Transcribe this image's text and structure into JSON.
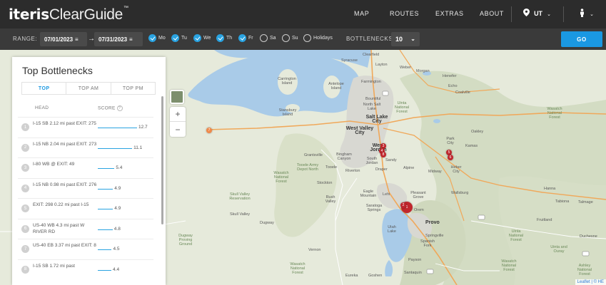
{
  "brand": {
    "bold": "iteris",
    "rest": "ClearGuide",
    "tm": "™"
  },
  "nav": {
    "items": [
      "MAP",
      "ROUTES",
      "EXTRAS",
      "ABOUT"
    ],
    "state": "UT",
    "location_icon": "location-pin-icon",
    "user_icon": "user-icon"
  },
  "filters": {
    "range_label": "RANGE:",
    "start_date": "07/01/2023",
    "end_date": "07/31/2023",
    "arrow": "→",
    "days": [
      {
        "label": "Mo",
        "checked": true
      },
      {
        "label": "Tu",
        "checked": true
      },
      {
        "label": "We",
        "checked": true
      },
      {
        "label": "Th",
        "checked": true
      },
      {
        "label": "Fr",
        "checked": true
      },
      {
        "label": "Sa",
        "checked": false
      },
      {
        "label": "Su",
        "checked": false
      },
      {
        "label": "Holidays",
        "checked": false
      }
    ],
    "bottlenecks_label": "BOTTLENECKS:",
    "bottlenecks_value": "10",
    "go_label": "GO"
  },
  "colors": {
    "accent": "#1a98e2",
    "nav_bg": "#2c2c2c",
    "filter_bg": "#3a3a3a",
    "marker": "#c0272d",
    "water": "#a9cbe8"
  },
  "panel": {
    "title": "Top Bottlenecks",
    "tabs": [
      {
        "label": "TOP",
        "active": true
      },
      {
        "label": "TOP AM",
        "active": false
      },
      {
        "label": "TOP PM",
        "active": false
      }
    ],
    "col_head": "HEAD",
    "col_score": "SCORE",
    "help": "?",
    "rows": [
      {
        "rank": "1",
        "head": "I-15 SB 2.12 mi past EXIT: 275",
        "score": "12.7"
      },
      {
        "rank": "2",
        "head": "I-15 NB 2.04 mi past EXIT: 273",
        "score": "11.1"
      },
      {
        "rank": "3",
        "head": "I-80 WB @ EXIT: 49",
        "score": "5.4"
      },
      {
        "rank": "4",
        "head": "I-15 NB 0.98 mi past EXIT: 276",
        "score": "4.9"
      },
      {
        "rank": "5",
        "head": "EXIT: 298 0.22 mi past I-15",
        "score": "4.9"
      },
      {
        "rank": "6",
        "head": "US-40 WB 4.3 mi past W RIVER RD",
        "score": "4.8"
      },
      {
        "rank": "7",
        "head": "US-40 EB 3.37 mi past EXIT: 8",
        "score": "4.5"
      },
      {
        "rank": "8",
        "head": "I-15 SB 1.72 mi past",
        "score": "4.4"
      }
    ]
  },
  "map": {
    "zoom_in": "+",
    "zoom_out": "−",
    "attribution": "Leaflet | © HE",
    "labels": [
      {
        "text": "Clearfield",
        "cls": ""
      },
      {
        "text": "Syracuse",
        "cls": ""
      },
      {
        "text": "Layton",
        "cls": ""
      },
      {
        "text": "Morgan",
        "cls": ""
      },
      {
        "text": "Henefer",
        "cls": ""
      },
      {
        "text": "Echo",
        "cls": ""
      },
      {
        "text": "Coalville",
        "cls": ""
      },
      {
        "text": "Farmington",
        "cls": ""
      },
      {
        "text": "Antelope Island",
        "cls": ""
      },
      {
        "text": "Carrington Island",
        "cls": ""
      },
      {
        "text": "Stansbury Island",
        "cls": ""
      },
      {
        "text": "Bountiful",
        "cls": ""
      },
      {
        "text": "North Salt Lake",
        "cls": ""
      },
      {
        "text": "Salt Lake City",
        "cls": "city"
      },
      {
        "text": "West Valley City",
        "cls": "city"
      },
      {
        "text": "West Jordan",
        "cls": "city"
      },
      {
        "text": "South Jordan",
        "cls": ""
      },
      {
        "text": "Sandy",
        "cls": ""
      },
      {
        "text": "Draper",
        "cls": ""
      },
      {
        "text": "Riverton",
        "cls": ""
      },
      {
        "text": "Bingham Canyon",
        "cls": ""
      },
      {
        "text": "Grantsville",
        "cls": ""
      },
      {
        "text": "Tooele",
        "cls": ""
      },
      {
        "text": "Tooele Army Depot North",
        "cls": "green"
      },
      {
        "text": "Wasatch National Forest",
        "cls": "green"
      },
      {
        "text": "Stockton",
        "cls": ""
      },
      {
        "text": "Rush Valley",
        "cls": ""
      },
      {
        "text": "Skull Valley Reservation",
        "cls": "green"
      },
      {
        "text": "Eagle Mountain",
        "cls": ""
      },
      {
        "text": "Lehi",
        "cls": ""
      },
      {
        "text": "Alpine",
        "cls": ""
      },
      {
        "text": "Pleasant Grove",
        "cls": ""
      },
      {
        "text": "Saratoga Springs",
        "cls": ""
      },
      {
        "text": "Orem",
        "cls": ""
      },
      {
        "text": "Provo",
        "cls": "city"
      },
      {
        "text": "Utah Lake",
        "cls": ""
      },
      {
        "text": "Springville",
        "cls": ""
      },
      {
        "text": "Spanish Fork",
        "cls": ""
      },
      {
        "text": "Payson",
        "cls": ""
      },
      {
        "text": "Santaquin",
        "cls": ""
      },
      {
        "text": "Goshen",
        "cls": ""
      },
      {
        "text": "Eureka",
        "cls": ""
      },
      {
        "text": "Vernon",
        "cls": ""
      },
      {
        "text": "Dugway",
        "cls": ""
      },
      {
        "text": "Dugway Proving Ground",
        "cls": "green"
      },
      {
        "text": "Park City",
        "cls": ""
      },
      {
        "text": "Kamas",
        "cls": ""
      },
      {
        "text": "Oakley",
        "cls": ""
      },
      {
        "text": "Heber City",
        "cls": ""
      },
      {
        "text": "Midway",
        "cls": ""
      },
      {
        "text": "Wallsburg",
        "cls": ""
      },
      {
        "text": "Hanna",
        "cls": ""
      },
      {
        "text": "Tabiona",
        "cls": ""
      },
      {
        "text": "Talmage",
        "cls": ""
      },
      {
        "text": "Fruitland",
        "cls": ""
      },
      {
        "text": "Duchesne",
        "cls": ""
      },
      {
        "text": "Wasatch National Forest",
        "cls": "green"
      },
      {
        "text": "Uinta and Ouray",
        "cls": "green"
      },
      {
        "text": "Uinta National Forest",
        "cls": "green"
      },
      {
        "text": "Wasatch National Forest",
        "cls": "green"
      },
      {
        "text": "Ashley National Forest",
        "cls": "green"
      },
      {
        "text": "Uinta National Forest",
        "cls": "green"
      },
      {
        "text": "Wasatch National Forest",
        "cls": "green"
      },
      {
        "text": "Weber",
        "cls": ""
      },
      {
        "text": "Skull Valley",
        "cls": ""
      }
    ],
    "markers": [
      "1",
      "2",
      "3",
      "4",
      "5",
      "6",
      "7",
      "8"
    ]
  }
}
